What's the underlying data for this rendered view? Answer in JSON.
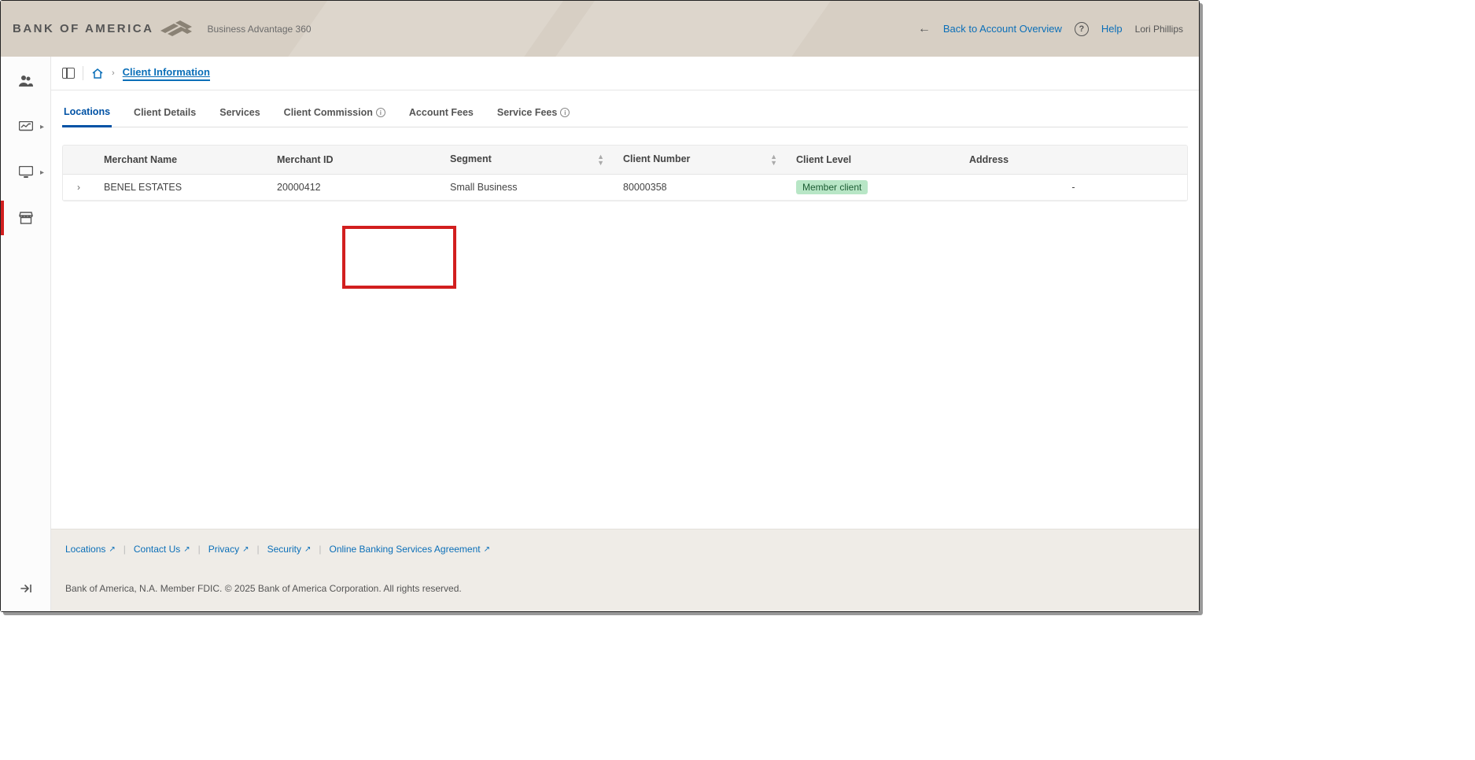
{
  "header": {
    "brand": "BANK OF AMERICA",
    "sub_brand": "Business Advantage 360",
    "back_link": "Back to Account Overview",
    "help": "Help",
    "user": "Lori Phillips"
  },
  "breadcrumb": {
    "current": "Client Information"
  },
  "tabs": [
    {
      "label": "Locations",
      "active": true
    },
    {
      "label": "Client Details"
    },
    {
      "label": "Services"
    },
    {
      "label": "Client Commission",
      "info": true
    },
    {
      "label": "Account Fees"
    },
    {
      "label": "Service Fees",
      "info": true
    }
  ],
  "table": {
    "columns": [
      {
        "label": ""
      },
      {
        "label": "Merchant Name"
      },
      {
        "label": "Merchant ID"
      },
      {
        "label": "Segment",
        "sortable": true
      },
      {
        "label": "Client Number",
        "sortable": true
      },
      {
        "label": "Client Level"
      },
      {
        "label": "Address"
      }
    ],
    "rows": [
      {
        "merchant_name": "BENEL ESTATES",
        "merchant_id": "20000412",
        "segment": "Small Business",
        "client_number": "80000358",
        "client_level": "Member client",
        "address": "-"
      }
    ]
  },
  "footer": {
    "links": [
      "Locations",
      "Contact Us",
      "Privacy",
      "Security",
      "Online Banking Services Agreement"
    ],
    "copyright": "Bank of America, N.A. Member FDIC. © 2025 Bank of America Corporation. All rights reserved."
  }
}
